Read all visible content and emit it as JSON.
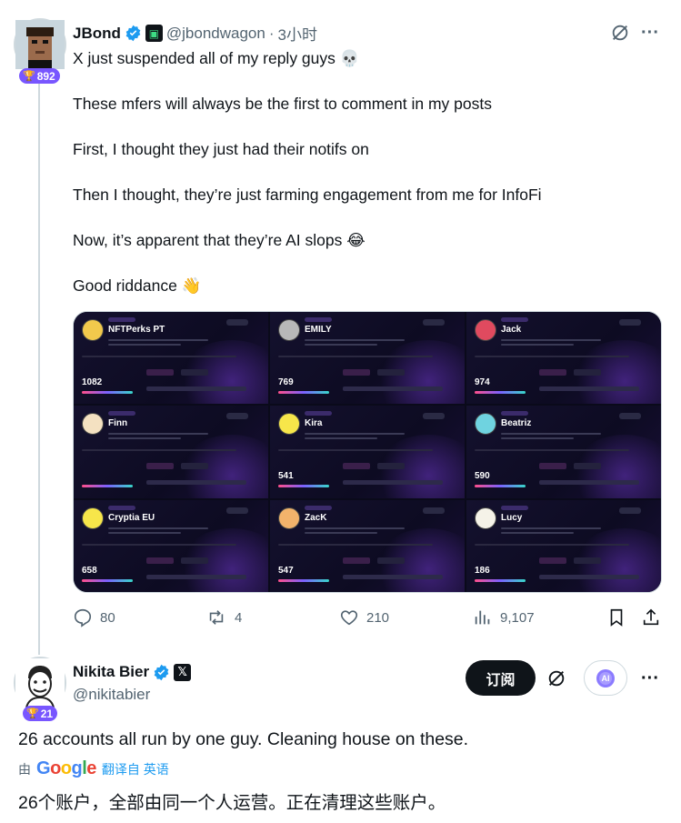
{
  "tweet1": {
    "author_name": "JBond",
    "handle": "@jbondwagon",
    "separator": "·",
    "time": "3小时",
    "badge_count": "892",
    "paragraphs": [
      "X just suspended all of my reply guys 💀",
      "These mfers will always be the first to comment in my posts",
      "First, I thought they just had their notifs on",
      "Then I thought, they’re just farming engagement from me for InfoFi",
      "Now, it’s apparent that they’re AI slops 😂",
      "Good riddance 👋"
    ],
    "media_cards": [
      {
        "name": "NFTPerks",
        "suffix": "PT",
        "score": "1082",
        "avatar_color": "#f2c94c"
      },
      {
        "name": "EMILY",
        "suffix": "",
        "score": "769",
        "avatar_color": "#b8b8b8"
      },
      {
        "name": "Jack",
        "suffix": "",
        "score": "974",
        "avatar_color": "#e04a5f"
      },
      {
        "name": "Finn",
        "suffix": "",
        "score": "",
        "avatar_color": "#f4e1c1"
      },
      {
        "name": "Kira",
        "suffix": "",
        "score": "541",
        "avatar_color": "#f7e64a"
      },
      {
        "name": "Beatriz",
        "suffix": "",
        "score": "590",
        "avatar_color": "#6fd3e0"
      },
      {
        "name": "Cryptia",
        "suffix": "EU",
        "score": "658",
        "avatar_color": "#f7e64a"
      },
      {
        "name": "ZacK",
        "suffix": "",
        "score": "547",
        "avatar_color": "#f2b36b"
      },
      {
        "name": "Lucy",
        "suffix": "",
        "score": "186",
        "avatar_color": "#f5f2e8"
      }
    ],
    "stats": {
      "replies": "80",
      "reposts": "4",
      "likes": "210",
      "views": "9,107"
    }
  },
  "tweet2": {
    "author_name": "Nikita Bier",
    "handle": "@nikitabier",
    "badge_count": "21",
    "subscribe_label": "订阅",
    "ai_label": "AI",
    "text": "26 accounts all run by one guy. Cleaning house on these.",
    "translate_prefix": "由",
    "translate_brand": "Google",
    "translate_link": "翻译自 英语",
    "translated_text": "26个账户，全部由同一个人运营。正在清理这些账户。"
  },
  "colors": {
    "accent": "#1d9bf0",
    "badge": "#7856ff",
    "text": "#0f1419",
    "muted": "#536471"
  }
}
